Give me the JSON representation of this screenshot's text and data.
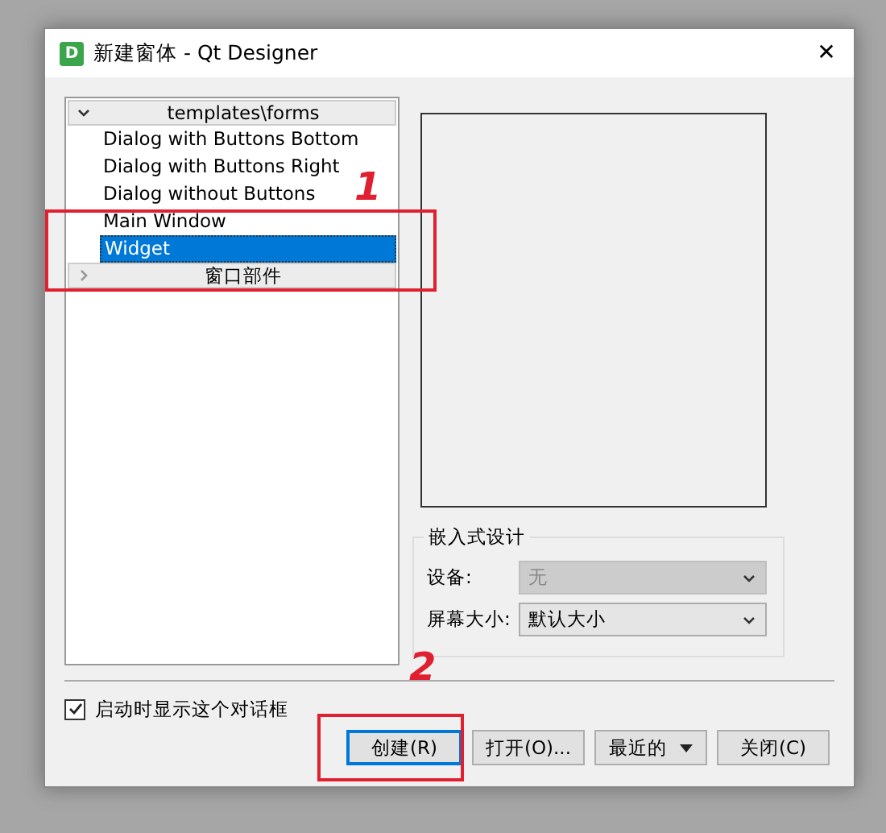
{
  "window": {
    "title": "新建窗体 - Qt Designer",
    "icon_letter": "D",
    "close": "✕"
  },
  "templates": [
    {
      "label": "templates\\forms",
      "expanded": true,
      "children": [
        {
          "label": "Dialog with Buttons Bottom",
          "selected": false
        },
        {
          "label": "Dialog with Buttons Right",
          "selected": false
        },
        {
          "label": "Dialog without Buttons",
          "selected": false
        },
        {
          "label": "Main Window",
          "selected": false
        },
        {
          "label": "Widget",
          "selected": true
        }
      ]
    },
    {
      "label": "窗口部件",
      "expanded": false
    }
  ],
  "embedded_design": {
    "title": "嵌入式设计",
    "fields": [
      {
        "label": "设备:",
        "value": "无",
        "disabled": true
      },
      {
        "label": "屏幕大小:",
        "value": "默认大小",
        "disabled": false
      }
    ]
  },
  "show_on_startup": {
    "label": "启动时显示这个对话框",
    "checked": true
  },
  "buttons": [
    {
      "label": "创建(R)",
      "kind": "button",
      "default": true
    },
    {
      "label": "打开(O)...",
      "kind": "button",
      "default": false
    },
    {
      "label": "最近的",
      "kind": "menu",
      "default": false
    },
    {
      "label": "关闭(C)",
      "kind": "button",
      "default": false
    }
  ],
  "annotations": [
    {
      "label": "1"
    },
    {
      "label": "2"
    }
  ]
}
